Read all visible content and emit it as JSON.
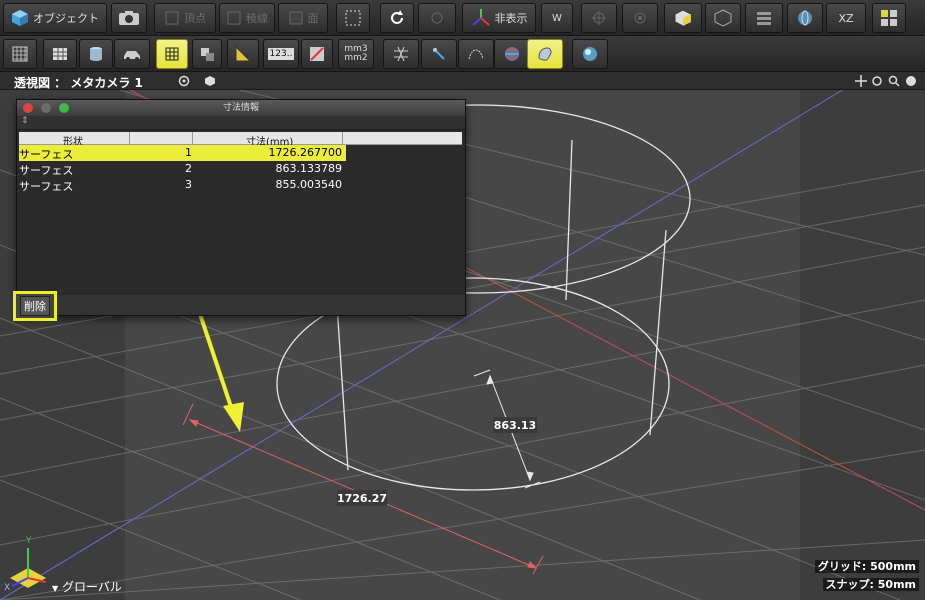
{
  "toolbar1": {
    "object_label": "オブジェクト",
    "vertex_label": "頂点",
    "edge_label": "稜線",
    "face_label": "面",
    "hide_label": "非表示",
    "xz_label": "XZ",
    "w_label": "W"
  },
  "toolbar2": {
    "numeric_label": "123..",
    "unit_label_top": "mm3",
    "unit_label_bottom": "mm2"
  },
  "viewport": {
    "title": "透視図 ： メタカメラ 1",
    "dim_label_1": "1726.27",
    "dim_label_2": "863.13",
    "grid_label": "グリッド: 500mm",
    "snap_label": "スナップ: 50mm",
    "global_label": "グローバル",
    "axis_y": "Y",
    "axis_x": "X"
  },
  "dialog": {
    "title": "寸法情報",
    "headers": [
      "形状",
      "",
      "寸法(mm)"
    ],
    "rows": [
      {
        "shape": "サーフェス",
        "index": "1",
        "value": "1726.267700",
        "selected": true
      },
      {
        "shape": "サーフェス",
        "index": "2",
        "value": "863.133789",
        "selected": false
      },
      {
        "shape": "サーフェス",
        "index": "3",
        "value": "855.003540",
        "selected": false
      }
    ],
    "delete_label": "削除"
  },
  "colors": {
    "highlight": "#ecec3a",
    "arrow": "#f0f032",
    "dimension_line": "#e06060",
    "axis_line": "#6a6acc"
  }
}
